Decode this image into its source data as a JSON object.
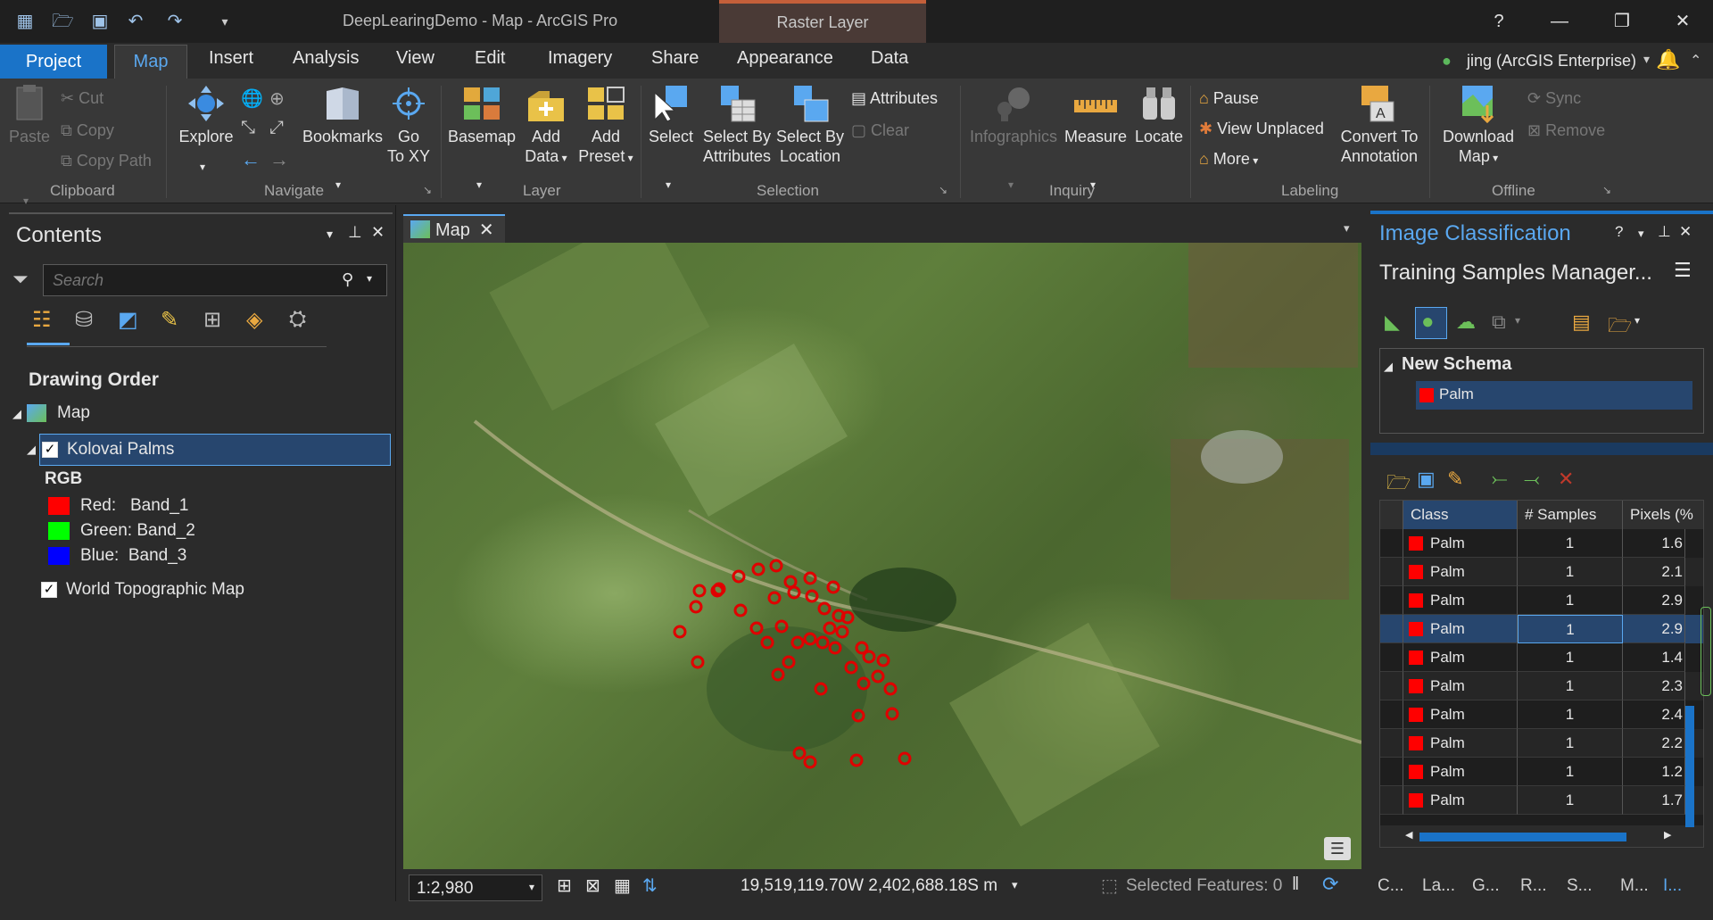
{
  "window": {
    "title": "DeepLearingDemo - Map - ArcGIS Pro",
    "context_tab": "Raster Layer",
    "help": "?",
    "minimize": "—",
    "maximize": "❐",
    "close": "✕"
  },
  "tabs": {
    "project": "Project",
    "map": "Map",
    "insert": "Insert",
    "analysis": "Analysis",
    "view": "View",
    "edit": "Edit",
    "imagery": "Imagery",
    "share": "Share",
    "appearance": "Appearance",
    "data": "Data"
  },
  "user": "jing (ArcGIS Enterprise)",
  "ribbon": {
    "clipboard": {
      "paste": "Paste",
      "cut": "Cut",
      "copy": "Copy",
      "copy_path": "Copy Path",
      "group": "Clipboard"
    },
    "navigate": {
      "explore": "Explore",
      "bookmarks": "Bookmarks",
      "goto_1": "Go",
      "goto_2": "To XY",
      "group": "Navigate"
    },
    "layer": {
      "basemap": "Basemap",
      "add_data_1": "Add",
      "add_data_2": "Data",
      "add_preset_1": "Add",
      "add_preset_2": "Preset",
      "group": "Layer"
    },
    "selection": {
      "select": "Select",
      "sba_1": "Select By",
      "sba_2": "Attributes",
      "sbl_1": "Select By",
      "sbl_2": "Location",
      "attributes": "Attributes",
      "clear": "Clear",
      "group": "Selection"
    },
    "inquiry": {
      "infographics": "Infographics",
      "measure": "Measure",
      "locate": "Locate",
      "group": "Inquiry"
    },
    "labeling": {
      "pause": "Pause",
      "view_unplaced": "View Unplaced",
      "more": "More",
      "convert_1": "Convert To",
      "convert_2": "Annotation",
      "group": "Labeling"
    },
    "offline": {
      "download_1": "Download",
      "download_2": "Map",
      "sync": "Sync",
      "remove": "Remove",
      "group": "Offline"
    }
  },
  "contents": {
    "title": "Contents",
    "search_placeholder": "Search",
    "drawing_order": "Drawing Order",
    "map": "Map",
    "layer": "Kolovai Palms",
    "rgb": "RGB",
    "red": "Red:   Band_1",
    "green": "Green: Band_2",
    "blue": "Blue:  Band_3",
    "basemap": "World Topographic Map",
    "colors": {
      "red": "#ff0000",
      "green": "#00ff00",
      "blue": "#0000ff"
    }
  },
  "map": {
    "tab": "Map",
    "scale": "1:2,980",
    "coords": "19,519,119.70W 2,402,688.18S m",
    "selected": "Selected Features: 0"
  },
  "image_classification": {
    "title": "Image Classification",
    "subtitle": "Training Samples Manager...",
    "schema": "New Schema",
    "schema_class": "Palm",
    "columns": {
      "class": "Class",
      "samples": "# Samples",
      "pixels": "Pixels (%"
    },
    "rows": [
      {
        "class": "Palm",
        "samples": "1",
        "pixels": "1.6"
      },
      {
        "class": "Palm",
        "samples": "1",
        "pixels": "2.1"
      },
      {
        "class": "Palm",
        "samples": "1",
        "pixels": "2.9"
      },
      {
        "class": "Palm",
        "samples": "1",
        "pixels": "2.9"
      },
      {
        "class": "Palm",
        "samples": "1",
        "pixels": "1.4"
      },
      {
        "class": "Palm",
        "samples": "1",
        "pixels": "2.3"
      },
      {
        "class": "Palm",
        "samples": "1",
        "pixels": "2.4"
      },
      {
        "class": "Palm",
        "samples": "1",
        "pixels": "2.2"
      },
      {
        "class": "Palm",
        "samples": "1",
        "pixels": "1.2"
      },
      {
        "class": "Palm",
        "samples": "1",
        "pixels": "1.7"
      }
    ],
    "bottom_tabs": [
      "C...",
      "La...",
      "G...",
      "R...",
      "S...",
      "M...",
      "I..."
    ]
  }
}
